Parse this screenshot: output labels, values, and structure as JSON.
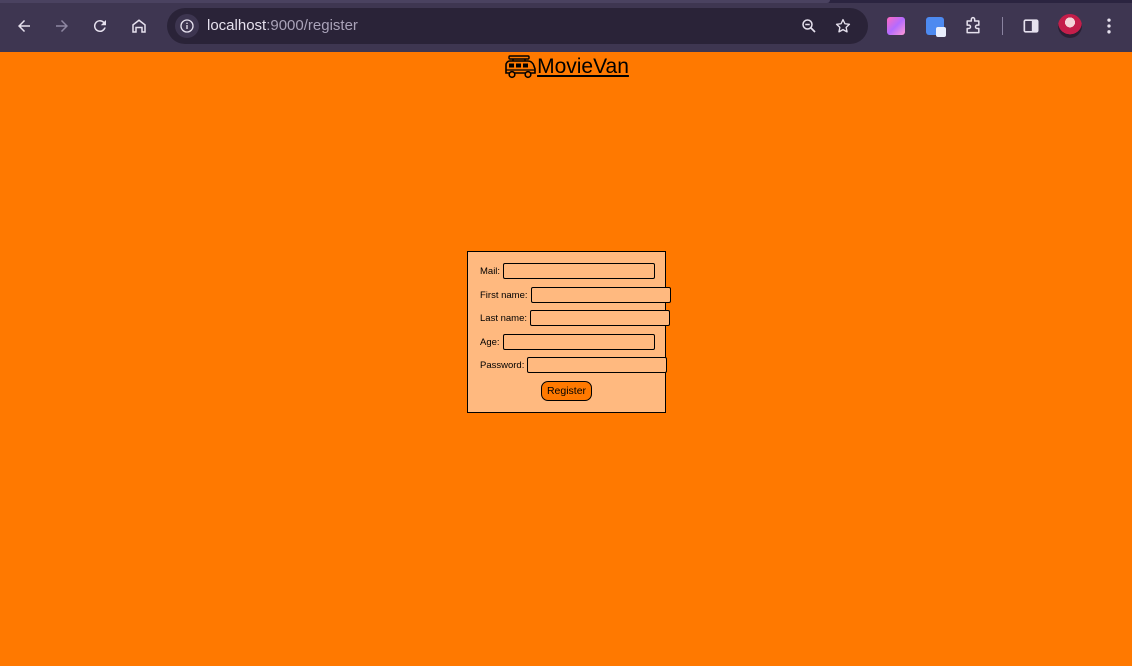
{
  "browser": {
    "url_host": "localhost",
    "url_path": ":9000/register",
    "icons": {
      "back": "back-arrow-icon",
      "forward": "forward-arrow-icon",
      "reload": "reload-icon",
      "home": "home-icon",
      "site_info": "info-icon",
      "zoom": "zoom-out-icon",
      "bookmark": "star-icon",
      "extension_1": "colorful-extension-icon",
      "extension_2": "translate-icon",
      "extensions": "puzzle-icon",
      "side_panel": "side-panel-icon",
      "profile": "avatar",
      "menu": "kebab-menu-icon"
    }
  },
  "header": {
    "brand_name": "MovieVan",
    "logo_icon": "van-icon"
  },
  "form": {
    "fields": [
      {
        "label": "Mail:",
        "value": ""
      },
      {
        "label": "First name:",
        "value": ""
      },
      {
        "label": "Last name:",
        "value": ""
      },
      {
        "label": "Age:",
        "value": ""
      },
      {
        "label": "Password:",
        "value": ""
      }
    ],
    "submit_label": "Register"
  },
  "colors": {
    "page_background": "#ff7900",
    "form_background": "#ffb97f",
    "chrome_background": "#3e3651"
  }
}
